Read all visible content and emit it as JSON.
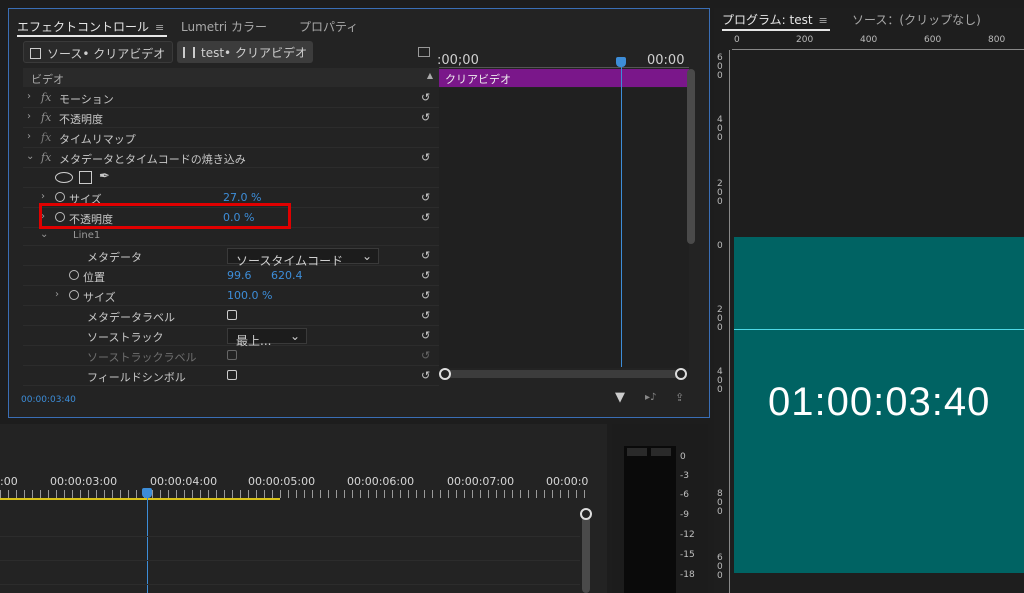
{
  "effects_panel": {
    "tabs": [
      "エフェクトコントロール",
      "Lumetri カラー",
      "プロパティ"
    ],
    "menu_glyph": "≡",
    "source_buttons": [
      "ソース• クリアビデオ",
      "test• クリアビデオ"
    ],
    "section_label": "ビデオ",
    "timeline_start": ":00;00",
    "timeline_end": "00:00",
    "clip_label": "クリアビデオ",
    "rows": {
      "motion": "モーション",
      "opacity": "不透明度",
      "time_remap": "タイムリマップ",
      "burn_in": "メタデータとタイムコードの焼き込み",
      "size": "サイズ",
      "size_value": "27.0 %",
      "opacity2": "不透明度",
      "opacity2_value": "0.0 %",
      "line1": "Line1",
      "metadata": "メタデータ",
      "metadata_value": "ソースタイムコード",
      "position": "位置",
      "position_x": "99.6",
      "position_y": "620.4",
      "size2": "サイズ",
      "size2_value": "100.0 %",
      "metadata_label": "メタデータラベル",
      "source_track": "ソーストラック",
      "source_track_value": "最上...",
      "source_track_label": "ソーストラックラベル",
      "field_symbol": "フィールドシンボル"
    },
    "current_time": "00:00:03:40"
  },
  "program_monitor": {
    "tab_program": "プログラム: test",
    "tab_menu": "≡",
    "tab_source": "ソース：(クリップなし)",
    "h_ruler": [
      "0",
      "200",
      "400",
      "600",
      "800"
    ],
    "timecode_overlay": "01:00:03:40",
    "colors": {
      "teal": "#006363",
      "cyan_line": "#4fd9e6"
    }
  },
  "timeline": {
    "timecodes": [
      ":00",
      "00:00:03:00",
      "00:00:04:00",
      "00:00:05:00",
      "00:00:06:00",
      "00:00:07:00",
      "00:00:0"
    ]
  },
  "audio_meter": {
    "scale": [
      "0",
      "-3",
      "-6",
      "-9",
      "-12",
      "-15",
      "-18"
    ]
  },
  "colors": {
    "accent_blue": "#3d8dd8",
    "clip_purple": "#7a178a",
    "highlight_red": "#e00000"
  }
}
